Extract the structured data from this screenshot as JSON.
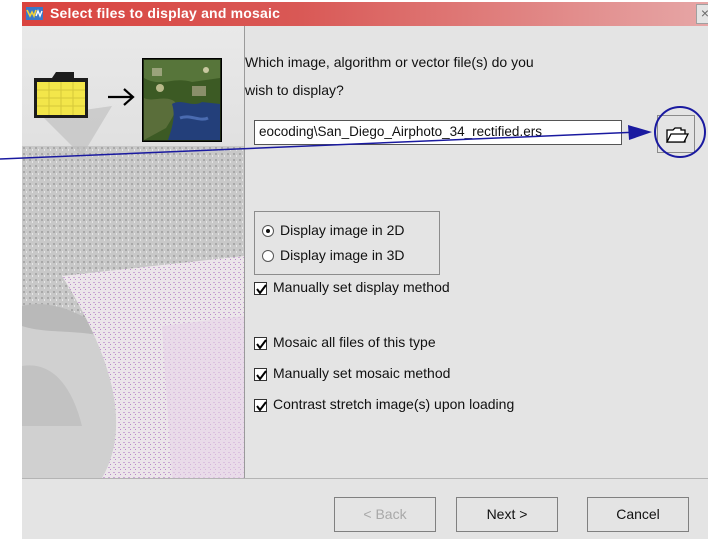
{
  "window": {
    "title": "Select files to display and mosaic",
    "close_label": "×"
  },
  "question": {
    "line1": "Which image, algorithm or vector file(s) do you",
    "line2": "wish to display?"
  },
  "file_input": {
    "value": "eocoding\\San_Diego_Airphoto_34_rectified.ers"
  },
  "display_mode": {
    "option_2d": "Display image in 2D",
    "option_3d": "Display image in 3D",
    "selected": "2D"
  },
  "checkboxes": {
    "manual_display": "Manually set display method",
    "mosaic_all": "Mosaic all files of this type",
    "manual_mosaic": "Manually set mosaic method",
    "contrast_stretch": "Contrast stretch image(s) upon loading"
  },
  "buttons": {
    "back": "< Back",
    "next": "Next >",
    "cancel": "Cancel"
  },
  "colors": {
    "title_bar": "#d9443f",
    "annotation": "#1a1aa0"
  },
  "icons": {
    "title": "ermapper-logo-icon",
    "folder": "folder-icon",
    "arrow": "arrow-right-icon",
    "thumbnail": "satellite-image-thumbnail",
    "browse": "open-folder-icon"
  }
}
